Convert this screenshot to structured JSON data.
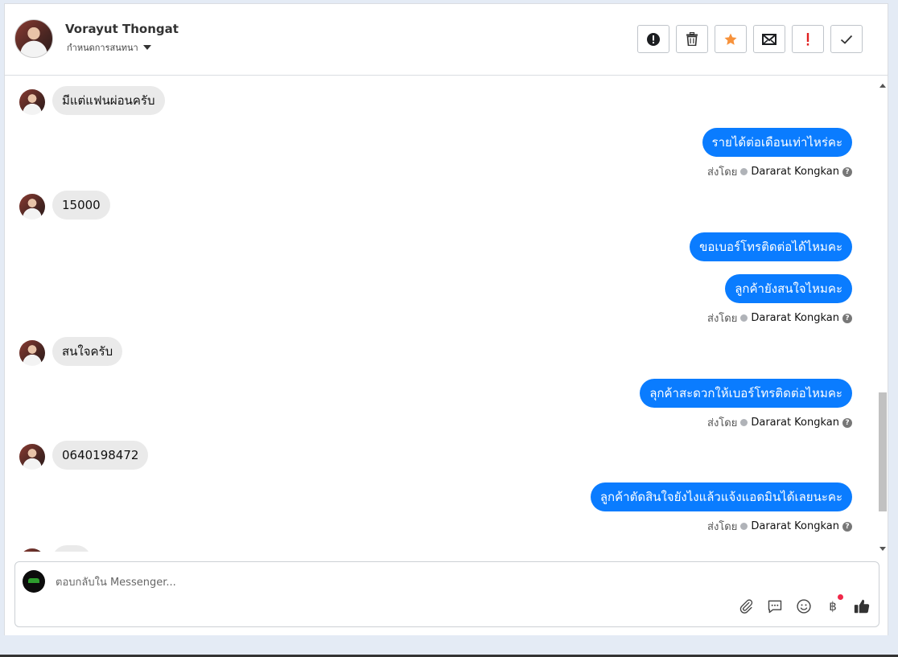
{
  "header": {
    "contact_name": "Vorayut Thongat",
    "assign_label": "กำหนดการสนทนา"
  },
  "actions": [
    {
      "name": "report-spam-button",
      "icon": "alert-circle-icon"
    },
    {
      "name": "delete-button",
      "icon": "trash-icon"
    },
    {
      "name": "star-button",
      "icon": "star-icon",
      "color": "#f7923b"
    },
    {
      "name": "mark-unread-button",
      "icon": "envelope-icon"
    },
    {
      "name": "mark-important-button",
      "icon": "exclamation-icon",
      "color": "#e02020"
    },
    {
      "name": "mark-done-button",
      "icon": "check-icon"
    }
  ],
  "messages": {
    "in_1": "มีแต่แฟนผ่อนครับ",
    "out_1": "รายได้ต่อเดือนเท่าไหร่คะ",
    "in_2": "15000",
    "out_2": "ขอเบอร์โทรติดต่อได้ไหมคะ",
    "out_3": "ลูกค้ายังสนใจไหมคะ",
    "in_3": "สนใจครับ",
    "out_4": "ลุกค้าสะดวกให้เบอร์โทรติดต่อไหมคะ",
    "in_4": "0640198472",
    "out_5": "ลูกค้าตัดสินใจยังไงแล้วแจ้งแอดมินได้เลยนะคะ"
  },
  "sent_by": {
    "label": "ส่งโดย",
    "agent": "Dararat Kongkan"
  },
  "composer": {
    "placeholder": "ตอบกลับใน Messenger...",
    "tools": [
      "paperclip-icon",
      "chat-bubble-icon",
      "smiley-icon",
      "baht-icon",
      "thumbs-up-icon"
    ],
    "baht_symbol": "฿"
  },
  "colors": {
    "outgoing_bubble": "#0a7cff",
    "incoming_bubble": "#eaeaea",
    "accent": "#1b74e4"
  }
}
